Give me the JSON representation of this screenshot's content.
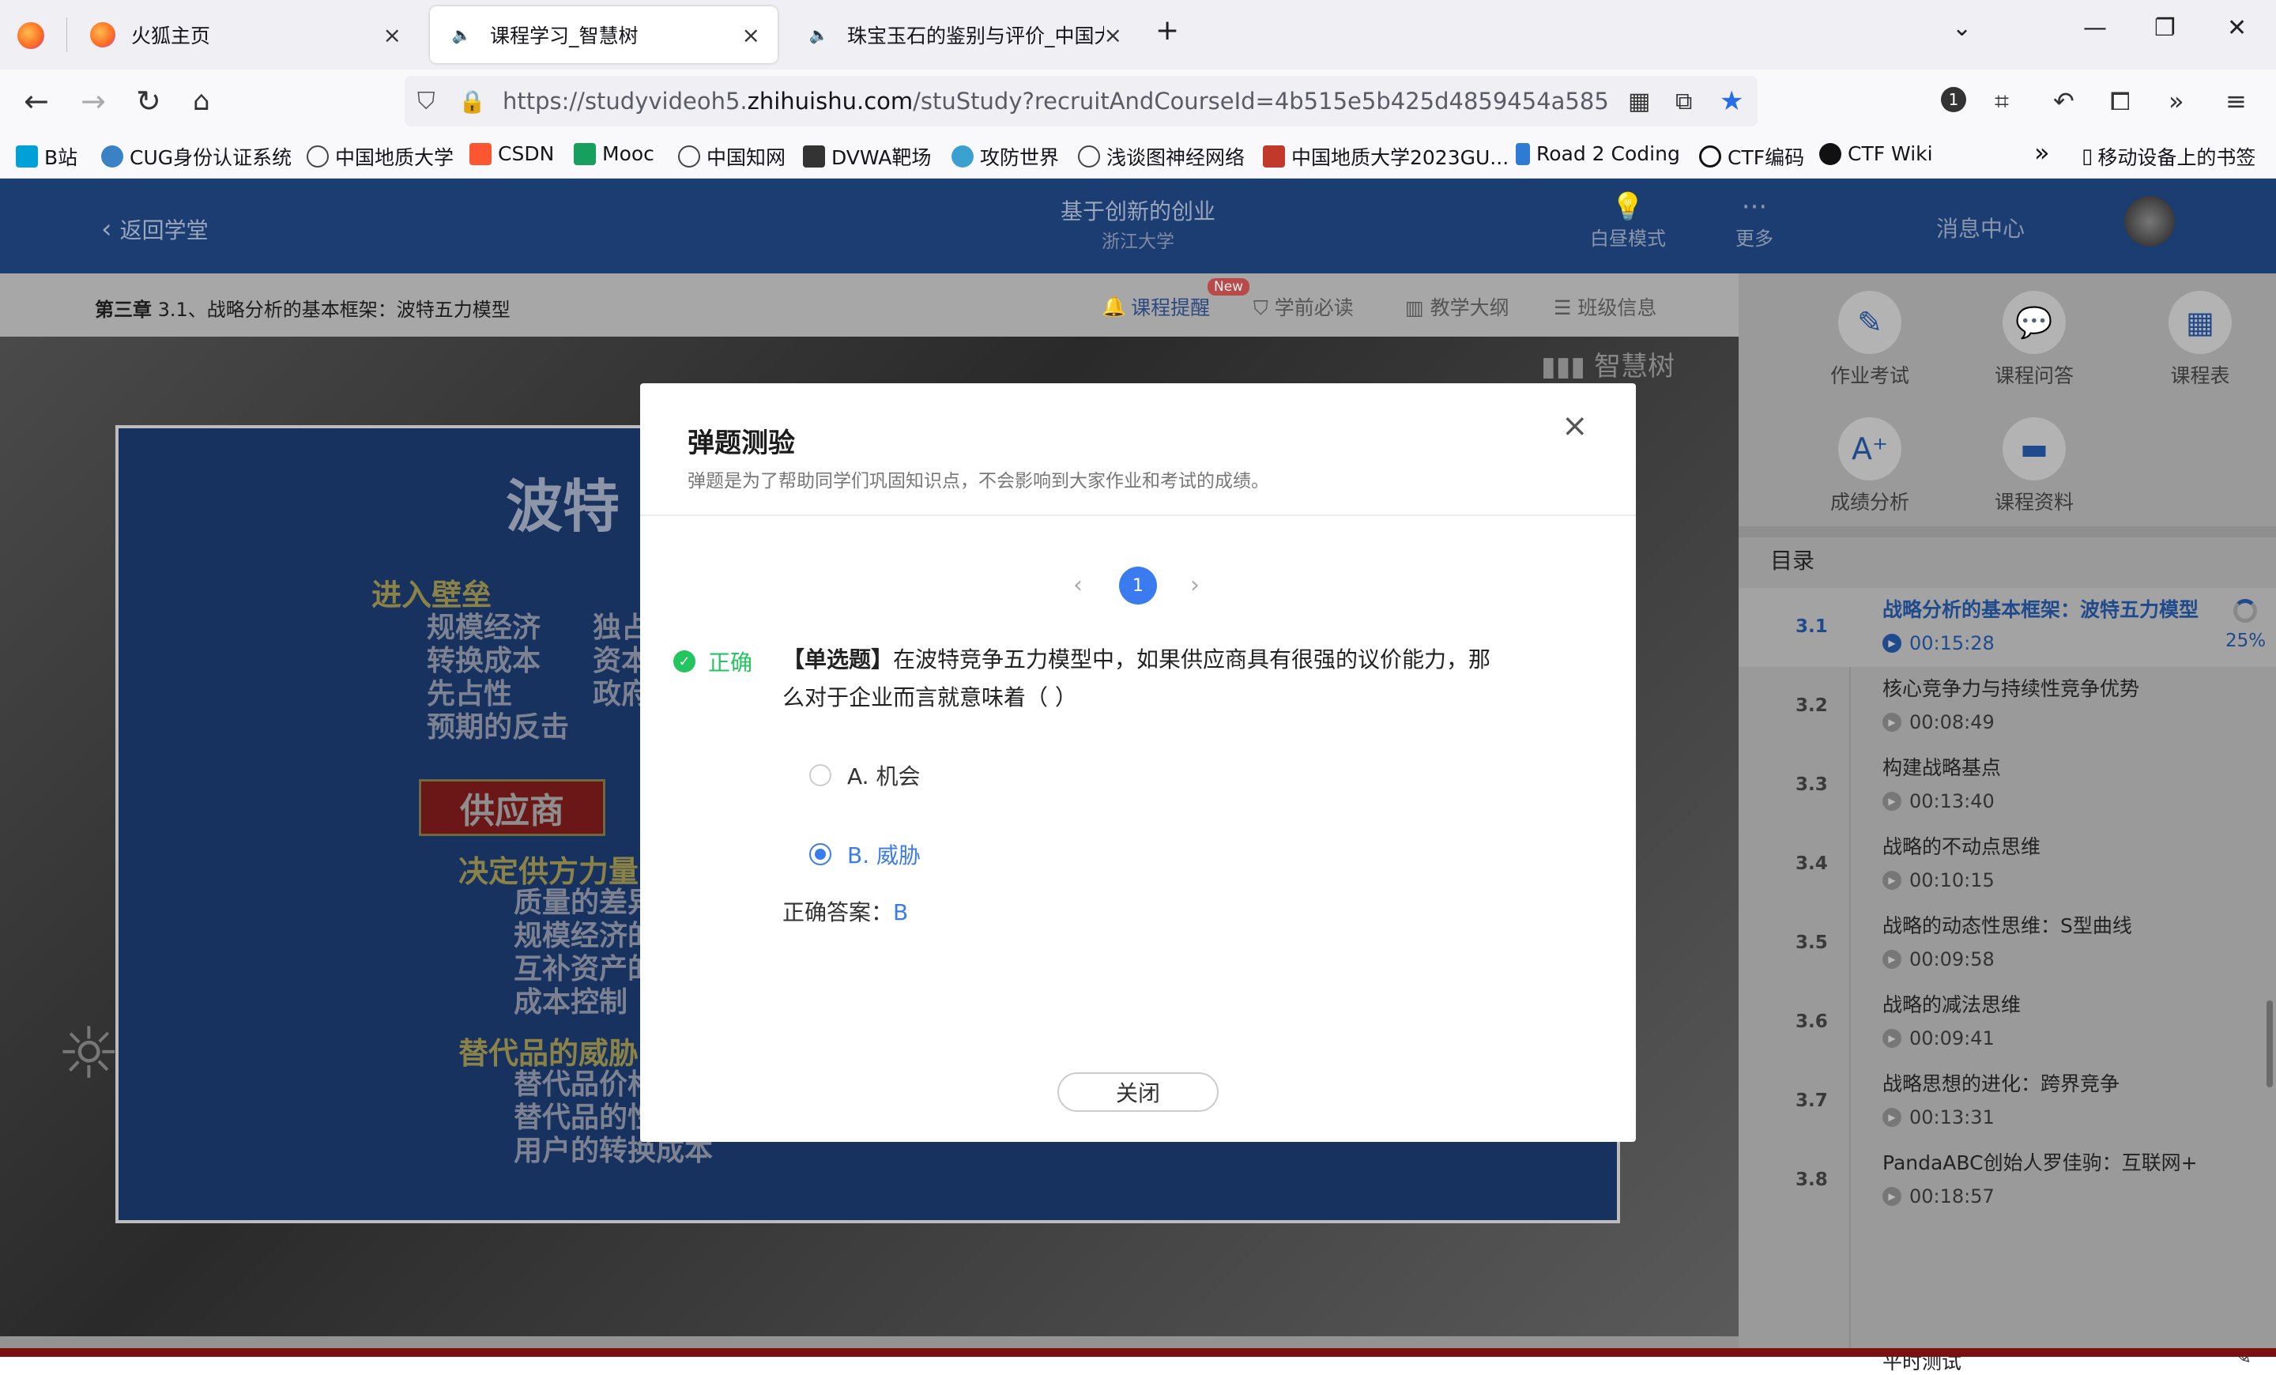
{
  "browser": {
    "tabs": [
      {
        "title": "火狐主页",
        "close": "×"
      },
      {
        "title": "课程学习_智慧树",
        "close": "×"
      },
      {
        "title": "珠宝玉石的鉴别与评价_中国大学",
        "close": "×"
      }
    ],
    "new_tab": "+",
    "url_host": "https://studyvideoh5.",
    "url_domain": "zhihuishu.com",
    "url_path": "/stuStudy?recruitAndCourseId=4b515e5b425d4859454a5859584d5142",
    "extension_badge": "1",
    "bookmarks": [
      "B站",
      "CUG身份认证系统",
      "中国地质大学",
      "CSDN",
      "Mooc",
      "中国知网",
      "DVWA靶场",
      "攻防世界",
      "浅谈图神经网络",
      "中国地质大学2023GU...",
      "Road 2 Coding",
      "CTF编码",
      "CTF Wiki"
    ],
    "mobile_bookmarks": "移动设备上的书签"
  },
  "header": {
    "back": "返回学堂",
    "course_title": "基于创新的创业",
    "university": "浙江大学",
    "day_mode": "白昼模式",
    "more": "更多",
    "messages": "消息中心"
  },
  "subbar": {
    "chapter_label": "第三章",
    "chapter_title": "3.1、战略分析的基本框架：波特五力模型",
    "tabs": [
      "课程提醒",
      "学前必读",
      "教学大纲",
      "班级信息"
    ],
    "new_badge": "New"
  },
  "video": {
    "watermark": "智慧树",
    "slide_title": "波特",
    "blocks": [
      {
        "heading": "进入壁垒",
        "lines": [
          "规模经济",
          "转换成本",
          "先占性",
          "预期的反击"
        ]
      },
      {
        "heading": "决定供方力量",
        "lines": [
          "质量的差异",
          "规模经济的",
          "互补资产的",
          "成本控制"
        ]
      },
      {
        "heading": "替代品的威胁",
        "lines": [
          "替代品价格",
          "替代品的性能",
          "用户的转换成本"
        ]
      }
    ],
    "side_chars": [
      "独占",
      "资本",
      "政府"
    ],
    "supplier_box": "供应商"
  },
  "sidebar": {
    "tools": [
      "作业考试",
      "课程问答",
      "课程表",
      "成绩分析",
      "课程资料"
    ],
    "toc_title": "目录",
    "lessons": [
      {
        "num": "3.1",
        "title": "战略分析的基本框架：波特五力模型",
        "duration": "00:15:28",
        "progress": "25%"
      },
      {
        "num": "3.2",
        "title": "核心竞争力与持续性竞争优势",
        "duration": "00:08:49"
      },
      {
        "num": "3.3",
        "title": "构建战略基点",
        "duration": "00:13:40"
      },
      {
        "num": "3.4",
        "title": "战略的不动点思维",
        "duration": "00:10:15"
      },
      {
        "num": "3.5",
        "title": "战略的动态性思维：S型曲线",
        "duration": "00:09:58"
      },
      {
        "num": "3.6",
        "title": "战略的减法思维",
        "duration": "00:09:41"
      },
      {
        "num": "3.7",
        "title": "战略思想的进化：跨界竞争",
        "duration": "00:13:31"
      },
      {
        "num": "3.8",
        "title": "PandaABC创始人罗佳驹：互联网+...",
        "duration": "00:18:57"
      }
    ],
    "quiz": "平时测试"
  },
  "modal": {
    "title": "弹题测验",
    "subtitle": "弹题是为了帮助同学们巩固知识点，不会影响到大家作业和考试的成绩。",
    "page": "1",
    "status": "正确",
    "qtype": "【单选题】",
    "question": "在波特竞争五力模型中，如果供应商具有很强的议价能力，那么对于企业而言就意味着（ ）",
    "options": [
      {
        "label": "A.  机会",
        "selected": false
      },
      {
        "label": "B.  威胁",
        "selected": true
      }
    ],
    "answer_label": "正确答案：",
    "answer_value": "B",
    "close_button": "关闭"
  },
  "colors": {
    "accent": "#3a7cf0",
    "correct": "#22c55e",
    "topnav": "#1b3d72"
  }
}
